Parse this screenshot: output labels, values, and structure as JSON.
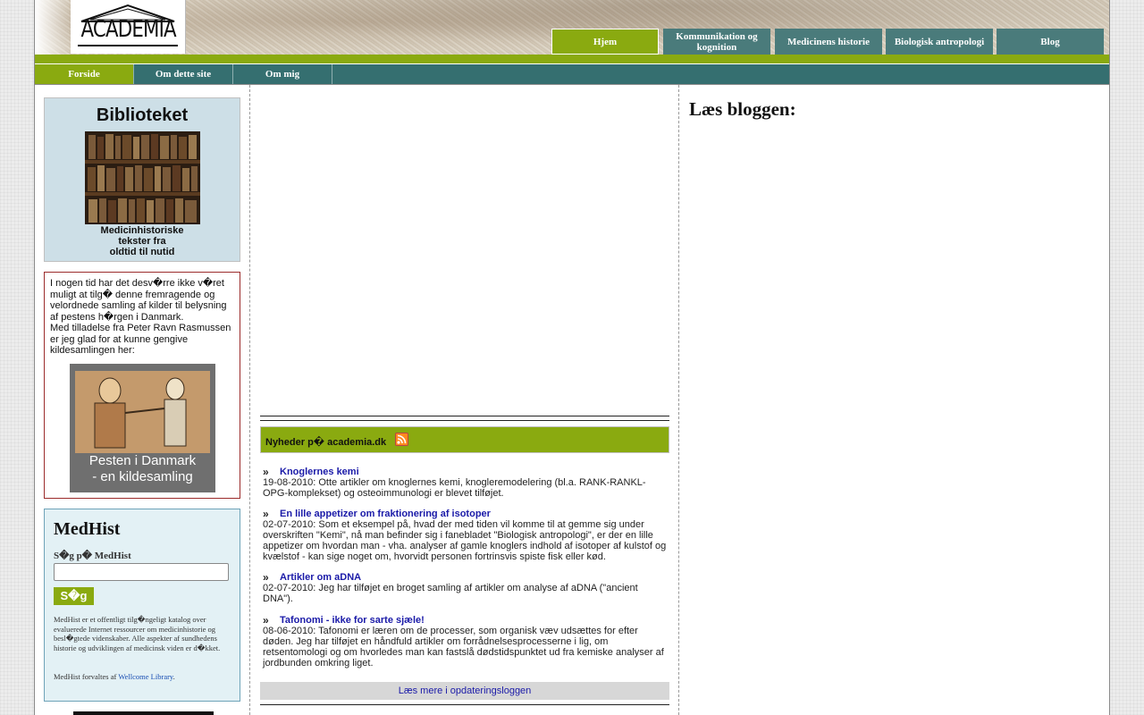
{
  "header": {
    "logo_text": "ACADEMIA",
    "tabs": [
      {
        "label": "Hjem",
        "active": true
      },
      {
        "label": "Kommunikation og kognition",
        "active": false
      },
      {
        "label": "Medicinens historie",
        "active": false
      },
      {
        "label": "Biologisk antropologi",
        "active": false
      },
      {
        "label": "Blog",
        "active": false
      }
    ]
  },
  "subnav": [
    {
      "label": "Forside",
      "active": true
    },
    {
      "label": "Om dette site",
      "active": false
    },
    {
      "label": "Om mig",
      "active": false
    }
  ],
  "sidebar": {
    "library": {
      "title": "Biblioteket",
      "caption_lines": [
        "Medicinhistoriske",
        "tekster fra",
        "oldtid til nutid"
      ]
    },
    "plague": {
      "text_1": "I nogen tid har det desv�rre ikke v�ret muligt at tilg� denne fremragende og velordnede samling af kilder til belysning af pestens h�rgen i Danmark.",
      "text_2": "Med tilladelse fra Peter Ravn Rasmussen er jeg glad for at kunne gengive kildesamlingen her:",
      "image_caption_1": "Pesten i Danmark",
      "image_caption_2": "- en kildesamling"
    },
    "medhist": {
      "title": "MedHist",
      "search_label": "S�g p� MedHist",
      "search_value": "",
      "button_label": "S�g",
      "description": "MedHist er et offentligt tilg�ngeligt katalog over evaluerede Internet ressourcer om medicinhistorie og besl�gtede videnskaber. Alle aspekter af sundhedens historie og udviklingen af medicinsk viden er d�kket.",
      "credit_prefix": "MedHist forvaltes af ",
      "credit_link": "Wellcome Library",
      "credit_suffix": "."
    }
  },
  "news": {
    "title": "Nyheder p� academia.dk",
    "rss_icon": "rss-icon",
    "items": [
      {
        "title": "Knoglernes kemi",
        "body": "19-08-2010: Otte artikler om knoglernes kemi, knogleremodelering (bl.a. RANK-RANKL-OPG-komplekset) og osteoimmunologi er blevet tilføjet."
      },
      {
        "title": "En lille appetizer om fraktionering af isotoper",
        "body": "02-07-2010: Som et eksempel på, hvad der med tiden vil komme til at gemme sig under overskriften \"Kemi\", nå man befinder sig i fanebladet \"Biologisk antropologi\", er der en lille appetizer om hvordan man - vha. analyser af gamle knoglers indhold af isotoper af kulstof og kvælstof - kan sige noget om, hvorvidt personen fortrinsvis spiste fisk eller kød."
      },
      {
        "title": "Artikler om aDNA",
        "body": "02-07-2010: Jeg har tilføjet en broget samling af artikler om analyse af aDNA (\"ancient DNA\")."
      },
      {
        "title": "Tafonomi - ikke for sarte sjæle!",
        "body": "08-06-2010: Tafonomi er læren om de processer, som organisk væv udsættes for efter døden. Jeg har tilføjet en håndfuld artikler om forrådnelsesprocesserne i lig, om retsentomologi og om hvorledes man kan fastslå dødstidspunktet ud fra kemiske analyser af jordbunden omkring liget."
      }
    ],
    "more_link": "Læs mere i opdateringsloggen"
  },
  "blog": {
    "title": "Læs bloggen:"
  },
  "colors": {
    "accent_green": "#8aaa10",
    "nav_teal": "#356f70",
    "tab_teal": "#4a7b7b",
    "link_blue": "#1a1aa8"
  }
}
